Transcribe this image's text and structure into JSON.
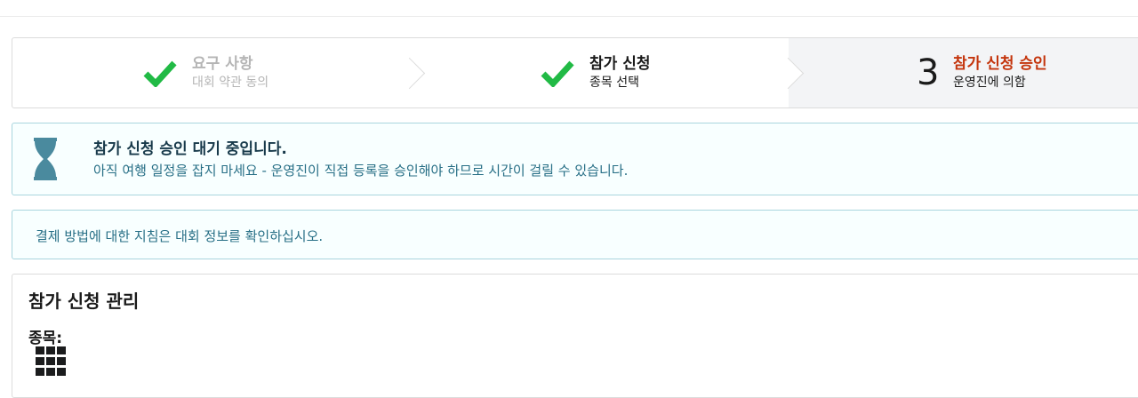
{
  "steps": [
    {
      "title": "요구 사항",
      "subtitle": "대회 약관 동의",
      "state": "completed",
      "icon": "check-icon"
    },
    {
      "title": "참가 신청",
      "subtitle": "종목 선택",
      "state": "completed",
      "icon": "check-icon"
    },
    {
      "number": "3",
      "title": "참가 신청 승인",
      "subtitle": "운영진에 의함",
      "state": "active"
    }
  ],
  "pending_message": {
    "icon": "hourglass-icon",
    "header": "참가 신청 승인 대기 중입니다.",
    "body": "아직 여행 일정을 잡지 마세요 - 운영진이 직접 등록을 승인해야 하므로 시간이 걸릴 수 있습니다."
  },
  "payment_message": {
    "body": "결제 방법에 대한 지침은 대회 정보를 확인하십시오."
  },
  "manage": {
    "title": "참가 신청 관리",
    "events_label": "종목:",
    "icon": "grid-icon"
  },
  "colors": {
    "check": "#21ba45",
    "active_title": "#c4350d",
    "info_text": "#276f86",
    "info_bg": "#f8ffff",
    "info_border": "#a9d5de"
  }
}
